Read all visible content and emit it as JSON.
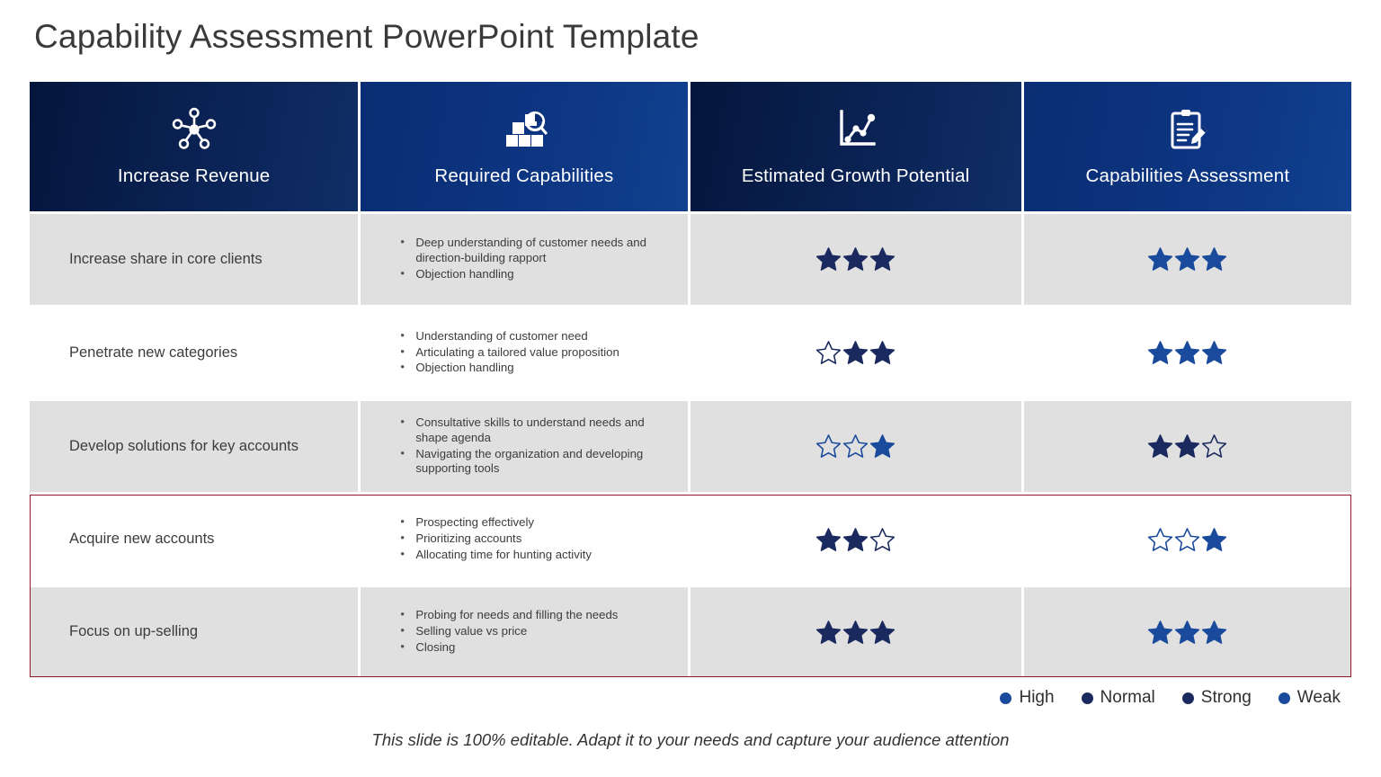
{
  "title": "Capability Assessment PowerPoint Template",
  "colors": {
    "header_dark": "#05163c",
    "header_light": "#0a2d73",
    "star_navy": "#1b2a5e",
    "star_blue": "#1a4a9c",
    "row_shaded": "#e0e0e0",
    "row_plain": "#ffffff",
    "highlight_border": "#8c1c2b",
    "text": "#3c3c3c"
  },
  "header": {
    "columns": [
      {
        "label": "Increase Revenue",
        "icon": "network-hub-icon",
        "style": "dark"
      },
      {
        "label": "Required Capabilities",
        "icon": "boxes-magnifier-icon",
        "style": "light"
      },
      {
        "label": "Estimated Growth Potential",
        "icon": "line-chart-icon",
        "style": "dark"
      },
      {
        "label": "Capabilities Assessment",
        "icon": "clipboard-pencil-icon",
        "style": "light"
      }
    ]
  },
  "rows": [
    {
      "objective": "Increase share in core clients",
      "capabilities": [
        "Deep understanding of customer needs and direction-building rapport",
        "Objection handling"
      ],
      "growth_potential": {
        "filled": [
          true,
          true,
          true
        ],
        "color": "navy"
      },
      "assessment": {
        "filled": [
          true,
          true,
          true
        ],
        "color": "blue"
      },
      "shaded": true,
      "highlighted": false
    },
    {
      "objective": "Penetrate new categories",
      "capabilities": [
        "Understanding of customer need",
        "Articulating a tailored value proposition",
        "Objection handling"
      ],
      "growth_potential": {
        "filled": [
          false,
          true,
          true
        ],
        "color": "navy"
      },
      "assessment": {
        "filled": [
          true,
          true,
          true
        ],
        "color": "blue"
      },
      "shaded": false,
      "highlighted": false
    },
    {
      "objective": "Develop solutions for key accounts",
      "capabilities": [
        "Consultative skills to understand needs and shape agenda",
        "Navigating the organization and developing supporting tools"
      ],
      "growth_potential": {
        "filled": [
          false,
          false,
          true
        ],
        "color": "blue"
      },
      "assessment": {
        "filled": [
          true,
          true,
          false
        ],
        "color": "navy"
      },
      "shaded": true,
      "highlighted": false
    },
    {
      "objective": "Acquire new accounts",
      "capabilities": [
        "Prospecting effectively",
        "Prioritizing accounts",
        "Allocating time for hunting activity"
      ],
      "growth_potential": {
        "filled": [
          true,
          true,
          false
        ],
        "color": "navy"
      },
      "assessment": {
        "filled": [
          false,
          false,
          true
        ],
        "color": "blue"
      },
      "shaded": false,
      "highlighted": true
    },
    {
      "objective": "Focus on up-selling",
      "capabilities": [
        "Probing for needs and filling the needs",
        "Selling value vs price",
        "Closing"
      ],
      "growth_potential": {
        "filled": [
          true,
          true,
          true
        ],
        "color": "navy"
      },
      "assessment": {
        "filled": [
          true,
          true,
          true
        ],
        "color": "blue"
      },
      "shaded": true,
      "highlighted": true
    }
  ],
  "legend": [
    {
      "label": "High",
      "color": "blue"
    },
    {
      "label": "Normal",
      "color": "navy"
    },
    {
      "label": "Strong",
      "color": "navy"
    },
    {
      "label": "Weak",
      "color": "blue"
    }
  ],
  "footer": "This slide is 100% editable. Adapt it to your needs and capture your audience attention"
}
